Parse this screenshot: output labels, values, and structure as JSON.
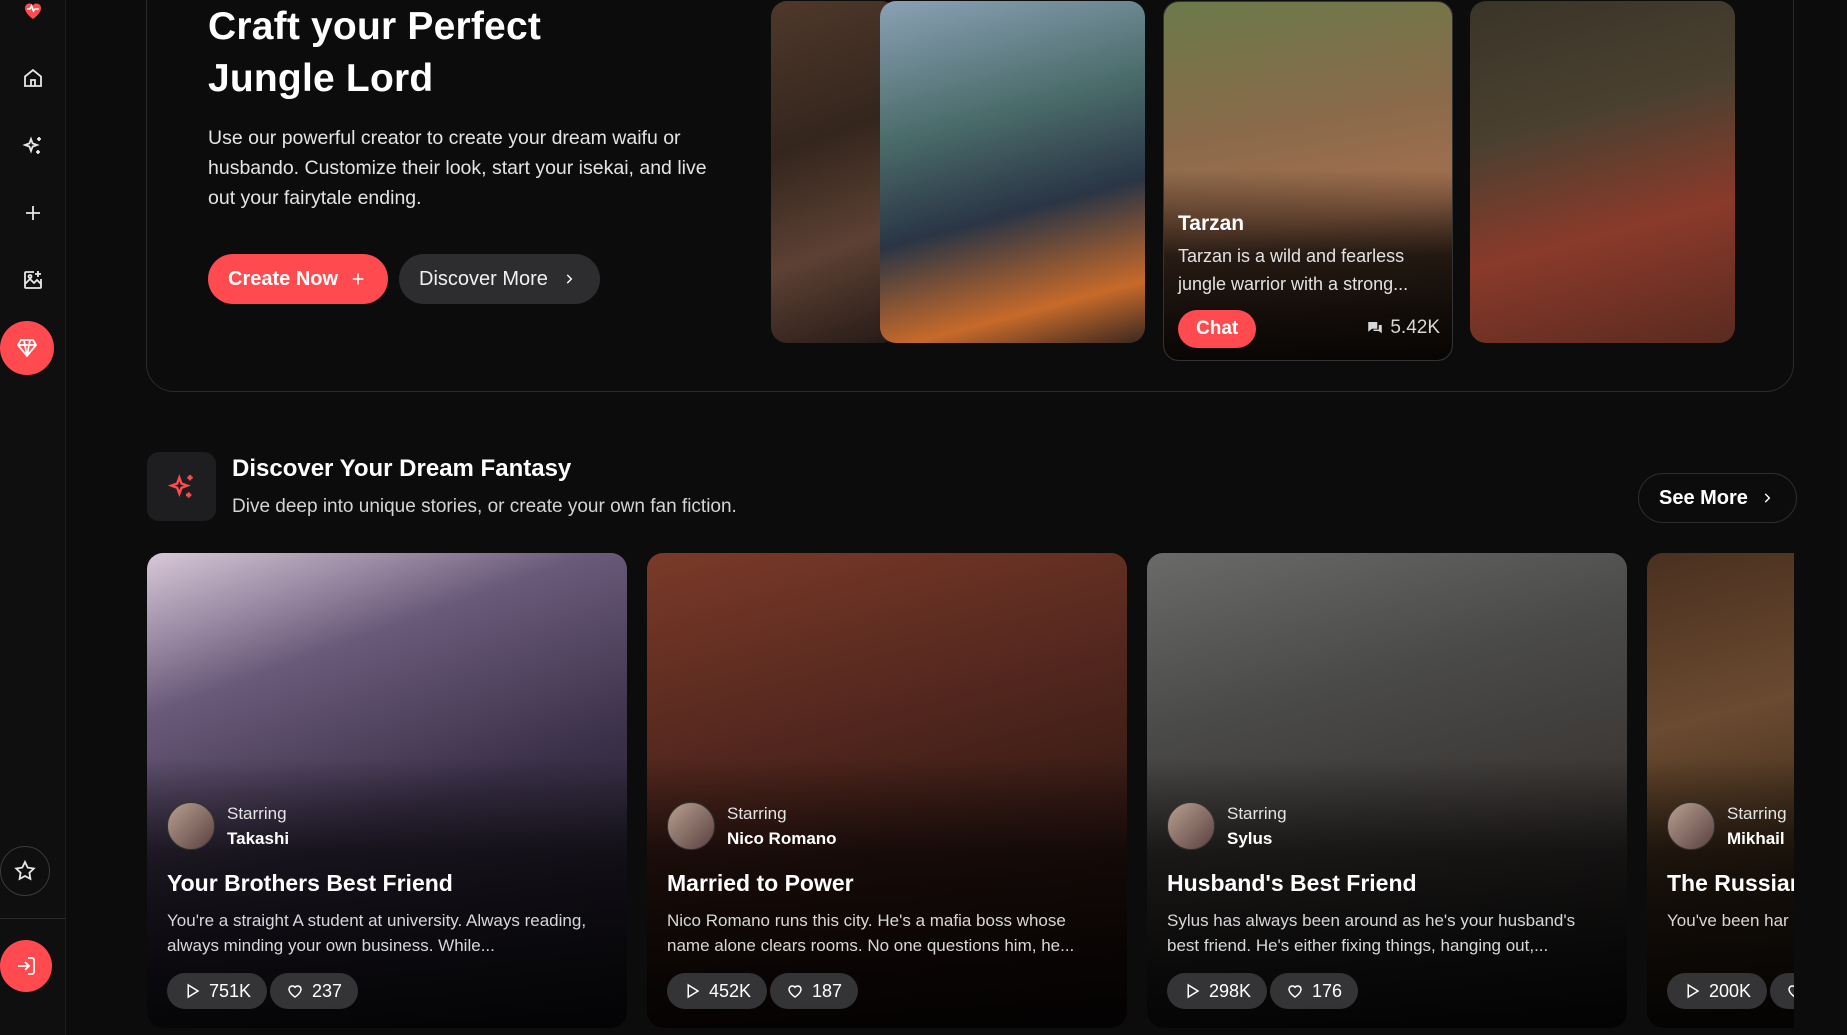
{
  "colors": {
    "accent": "#ff4b4f",
    "background": "#0c0c0d",
    "pill": "#2d2d2f"
  },
  "sidebar": {
    "items": [
      {
        "icon": "heartbeat-logo-icon"
      },
      {
        "icon": "home-icon"
      },
      {
        "icon": "sparkles-icon"
      },
      {
        "icon": "plus-icon"
      },
      {
        "icon": "image-edit-icon"
      },
      {
        "icon": "gem-icon"
      },
      {
        "icon": "star-icon"
      },
      {
        "icon": "login-icon"
      }
    ]
  },
  "hero": {
    "title_line1": "Craft your Perfect",
    "title_line2": "Jungle Lord",
    "description": "Use our powerful creator to create your dream waifu or husbando. Customize their look, start your isekai, and live out your fairytale ending.",
    "create_label": "Create Now",
    "discover_label": "Discover More",
    "featured": {
      "name": "Tarzan",
      "description": "Tarzan is a wild and fearless jungle warrior with a strong...",
      "chat_label": "Chat",
      "chat_count": "5.42K"
    }
  },
  "section": {
    "title": "Discover Your Dream Fantasy",
    "subtitle": "Dive deep into unique stories, or create your own fan fiction.",
    "see_more_label": "See More"
  },
  "stories": [
    {
      "starring": "Starring",
      "character": "Takashi",
      "title": "Your Brothers Best Friend",
      "description": "You're a straight A student at university. Always reading, always minding your own business. While...",
      "plays": "751K",
      "likes": "237"
    },
    {
      "starring": "Starring",
      "character": "Nico Romano",
      "title": "Married to Power",
      "description": "Nico Romano runs this city. He's a mafia boss whose name alone clears rooms. No one questions him, he...",
      "plays": "452K",
      "likes": "187"
    },
    {
      "starring": "Starring",
      "character": "Sylus",
      "title": "Husband's Best Friend",
      "description": "Sylus has always been around as he's your husband's best friend. He's either fixing things, hanging out,...",
      "plays": "298K",
      "likes": "176"
    },
    {
      "starring": "Starring",
      "character": "Mikhail",
      "title": "The Russian",
      "description": "You've been har Russian Mafia's",
      "plays": "200K",
      "likes": ""
    }
  ]
}
